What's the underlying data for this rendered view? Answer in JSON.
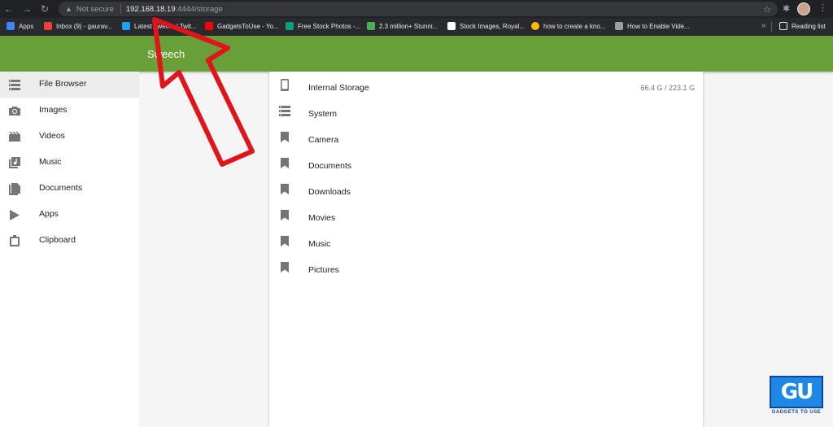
{
  "browser": {
    "not_secure": "Not secure",
    "url_host": "192.168.18.19",
    "url_path": ":4444/storage",
    "reading_list": "Reading list"
  },
  "bookmarks": [
    {
      "label": "Apps",
      "color": "#4285f4"
    },
    {
      "label": "Inbox (9) - gaurav...",
      "color": "#ea4335"
    },
    {
      "label": "Latest Tweets / Twit...",
      "color": "#1da1f2"
    },
    {
      "label": "GadgetsToUse - Yo...",
      "color": "#ff0000"
    },
    {
      "label": "Free Stock Photos -...",
      "color": "#05a081"
    },
    {
      "label": "2.3 million+ Stunni...",
      "color": "#4caf50"
    },
    {
      "label": "Stock Images, Royal...",
      "color": "#ffffff"
    },
    {
      "label": "how to create a kno...",
      "color": "#fbbc05"
    },
    {
      "label": "How to Enable Vide...",
      "color": "#9e9e9e"
    }
  ],
  "app": {
    "title": "Sweech",
    "accent_color": "#689f38"
  },
  "sidebar": {
    "items": [
      {
        "label": "File Browser",
        "icon": "storage-icon",
        "active": true
      },
      {
        "label": "Images",
        "icon": "camera-icon"
      },
      {
        "label": "Videos",
        "icon": "film-icon"
      },
      {
        "label": "Music",
        "icon": "music-library-icon"
      },
      {
        "label": "Documents",
        "icon": "documents-icon"
      },
      {
        "label": "Apps",
        "icon": "play-icon"
      },
      {
        "label": "Clipboard",
        "icon": "clipboard-icon"
      }
    ]
  },
  "storage": {
    "items": [
      {
        "label": "Internal Storage",
        "icon": "phone-icon",
        "size": "66.4 G / 223.1 G"
      },
      {
        "label": "System",
        "icon": "storage-icon"
      },
      {
        "label": "Camera",
        "icon": "bookmark-icon"
      },
      {
        "label": "Documents",
        "icon": "bookmark-icon"
      },
      {
        "label": "Downloads",
        "icon": "bookmark-icon"
      },
      {
        "label": "Movies",
        "icon": "bookmark-icon"
      },
      {
        "label": "Music",
        "icon": "bookmark-icon"
      },
      {
        "label": "Pictures",
        "icon": "bookmark-icon"
      }
    ]
  },
  "watermark": {
    "mark": "GU",
    "text": "GADGETS TO USE"
  }
}
